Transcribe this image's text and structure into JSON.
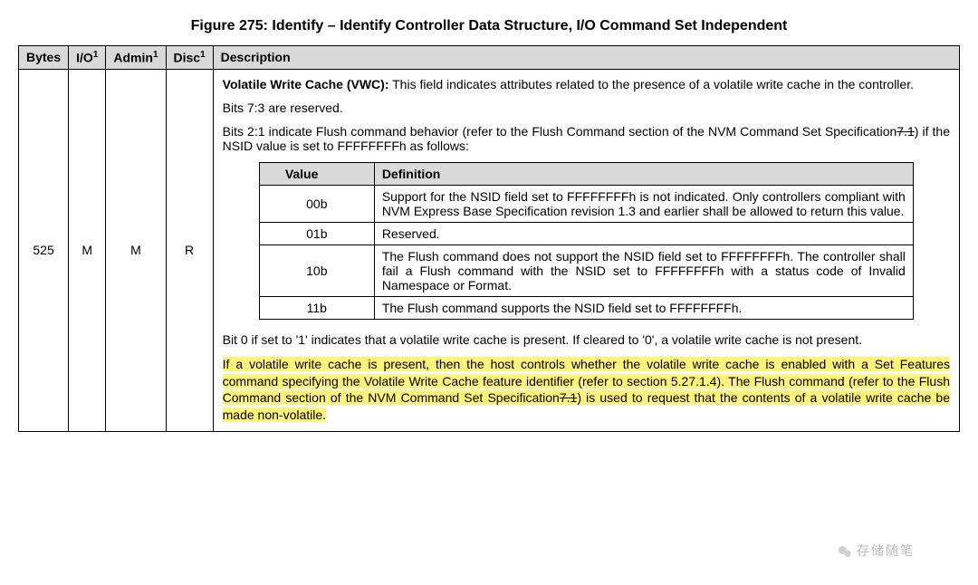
{
  "figure_title": "Figure 275: Identify – Identify Controller Data Structure, I/O Command Set Independent",
  "headers": {
    "bytes": "Bytes",
    "io": "I/O",
    "admin": "Admin",
    "disc": "Disc",
    "description": "Description",
    "note_sup": "1"
  },
  "row": {
    "bytes": "525",
    "io": "M",
    "admin": "M",
    "disc": "R"
  },
  "desc": {
    "vwc_bold": "Volatile Write Cache (VWC):",
    "vwc_text": " This field indicates attributes related to the presence of a volatile write cache in the controller.",
    "bits73": "Bits 7:3 are reserved.",
    "bits21a": "Bits 2:1 indicate Flush command behavior (refer to the Flush Command section of the NVM Command Set Specification",
    "strike1": "7.1",
    "bits21b": ") if the NSID value is set to FFFFFFFFh as follows:",
    "bit0": "Bit 0 if set to '1' indicates that a volatile write cache is present. If cleared to '0', a volatile write cache is not present.",
    "hl_a": "If a volatile write cache is present, then the host controls whether the volatile write cache is enabled with a Set Features command specifying the Volatile Write Cache feature identifier (refer to section 5.27.1.4). The Flush command (refer to the Flush Command section of the NVM Command Set Specification",
    "hl_strike": "7.1",
    "hl_b": ") is used to request that the contents of a volatile write cache be made non-volatile."
  },
  "inner_headers": {
    "value": "Value",
    "definition": "Definition"
  },
  "inner_rows": [
    {
      "value": "00b",
      "definition": "Support for the NSID field set to FFFFFFFFh is not indicated. Only controllers compliant with NVM Express Base Specification revision 1.3 and earlier shall be allowed to return this value."
    },
    {
      "value": "01b",
      "definition": "Reserved."
    },
    {
      "value": "10b",
      "definition": "The Flush command does not support the NSID field set to FFFFFFFFh. The controller shall fail a Flush command with the NSID set to FFFFFFFFh with a status code of Invalid Namespace or Format."
    },
    {
      "value": "11b",
      "definition": "The Flush command supports the NSID field set to FFFFFFFFh."
    }
  ],
  "watermark": "存储随笔"
}
